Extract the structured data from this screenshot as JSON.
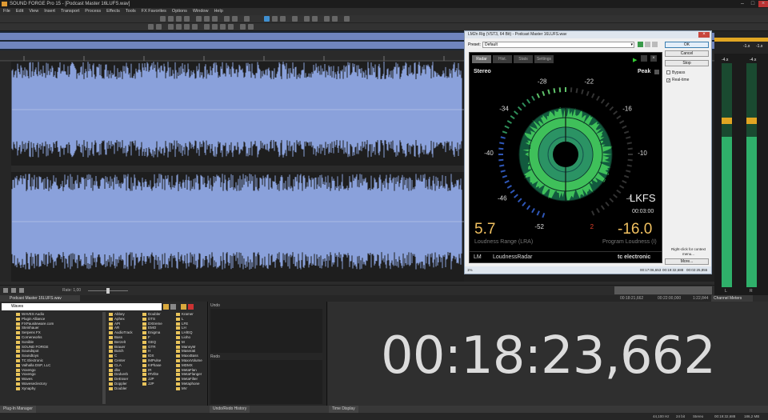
{
  "app": {
    "title": "SOUND FORGE Pro 15 - [Podcast Master 16LUFS.wav]"
  },
  "menu": [
    "File",
    "Edit",
    "View",
    "Insert",
    "Transport",
    "Process",
    "Effects",
    "Tools",
    "FX Favorites",
    "Options",
    "Window",
    "Help"
  ],
  "dialog": {
    "title": "LM2n Rig (VST3, 64 Bit) - Podcast Master 16LUFS.wav",
    "preset_label": "Preset:",
    "preset_value": "Default",
    "buttons": {
      "ok": "OK",
      "cancel": "Cancel",
      "stop": "Stop",
      "more": "More..."
    },
    "checks": {
      "bypass": "Bypass",
      "realtime": "Real-time"
    },
    "hint": "Right-click for context menu...",
    "status": {
      "left": "1%",
      "time1": "00:17:06,653",
      "time2": "00:19:32,688",
      "time3": "00:02:25,855"
    },
    "radar": {
      "tabs": [
        "Radar",
        "Hist.",
        "Stats",
        "Settings"
      ],
      "mode_left": "Stereo",
      "mode_right": "Peak",
      "scale": [
        "-52",
        "-46",
        "-40",
        "-34",
        "-28",
        "-22",
        "-16",
        "-10",
        "-4",
        "2"
      ],
      "unit": "LKFS",
      "time": "00:03:00",
      "lra_value": "5.7",
      "lra_label": "Loudness Range (LRA)",
      "program_value": "-16.0",
      "program_label": "Program Loudness (I)",
      "brand_left_a": "LM",
      "brand_left_b": "LoudnessRadar",
      "brand_right": "tc electronic"
    }
  },
  "transport": {
    "rate_label": "Rate: 1,00"
  },
  "selection": {
    "start": "00:18:21,662",
    "end": "00:22:00,000",
    "length": "1:22,844"
  },
  "meters": {
    "title": "Channel Meters",
    "peaks": [
      "-1.x",
      "-1.x"
    ],
    "vals": [
      "-4.x",
      "-4.x"
    ],
    "levels": [
      0.67,
      0.67
    ],
    "labels": [
      "L",
      "R"
    ]
  },
  "explorer": {
    "path": "Waves",
    "tree": [
      "WAVES Audio",
      "Plugin Alliance",
      "FXPausiteware.com",
      "Steinhauer",
      "Serpens FX",
      "Cornerworks",
      "Sonible",
      "SOUND FORGE",
      "Soundspot",
      "Soundtoys",
      "TC Electronic",
      "Valhalla DSP, LLC",
      "Voxengo",
      "Voxengo",
      "Waves",
      "Waveseclectory",
      "Xynaphy"
    ],
    "col1": [
      "Abbey",
      "Aphex",
      "API",
      "AR",
      "AudioTrack",
      "Bass",
      "Berzelt",
      "Brauer",
      "Butch",
      "C",
      "Center",
      "CLA",
      "dbx",
      "Dedverb",
      "DeEsser",
      "Doppler",
      "Doubler"
    ],
    "col2": [
      "Doubler",
      "DTS",
      "DXtreme",
      "EMO",
      "Enigma",
      "F",
      "GEQ",
      "GTR",
      "H",
      "IDX",
      "IMPulse",
      "InPhase",
      "IR",
      "IRVlite",
      "JJP",
      "JJP"
    ],
    "col3": [
      "Kramer",
      "L",
      "LFE",
      "LH",
      "LH/EQ",
      "Lioho",
      "M",
      "MannyM",
      "Maserati",
      "MaxxBass",
      "MaxxVolume",
      "MDMX",
      "MetaFlan",
      "MetaFlanger",
      "MetaFilter",
      "Metaphone",
      "MV"
    ],
    "panel_label": "Plug-In Manager"
  },
  "history": {
    "top_label": "Undo",
    "bottom_label": "Redo",
    "panel_label": "Undo/Redo History"
  },
  "time_display": {
    "value": "00:18:23,662",
    "panel_label": "Time Display"
  },
  "statusbar": {
    "sr": "44,100 Hz",
    "bits": "24 bit",
    "ch": "Stereo",
    "len": "00:19:32,688",
    "size": "186,2 MB"
  },
  "file_tab": "Podcast Master 16LUFS.wav"
}
